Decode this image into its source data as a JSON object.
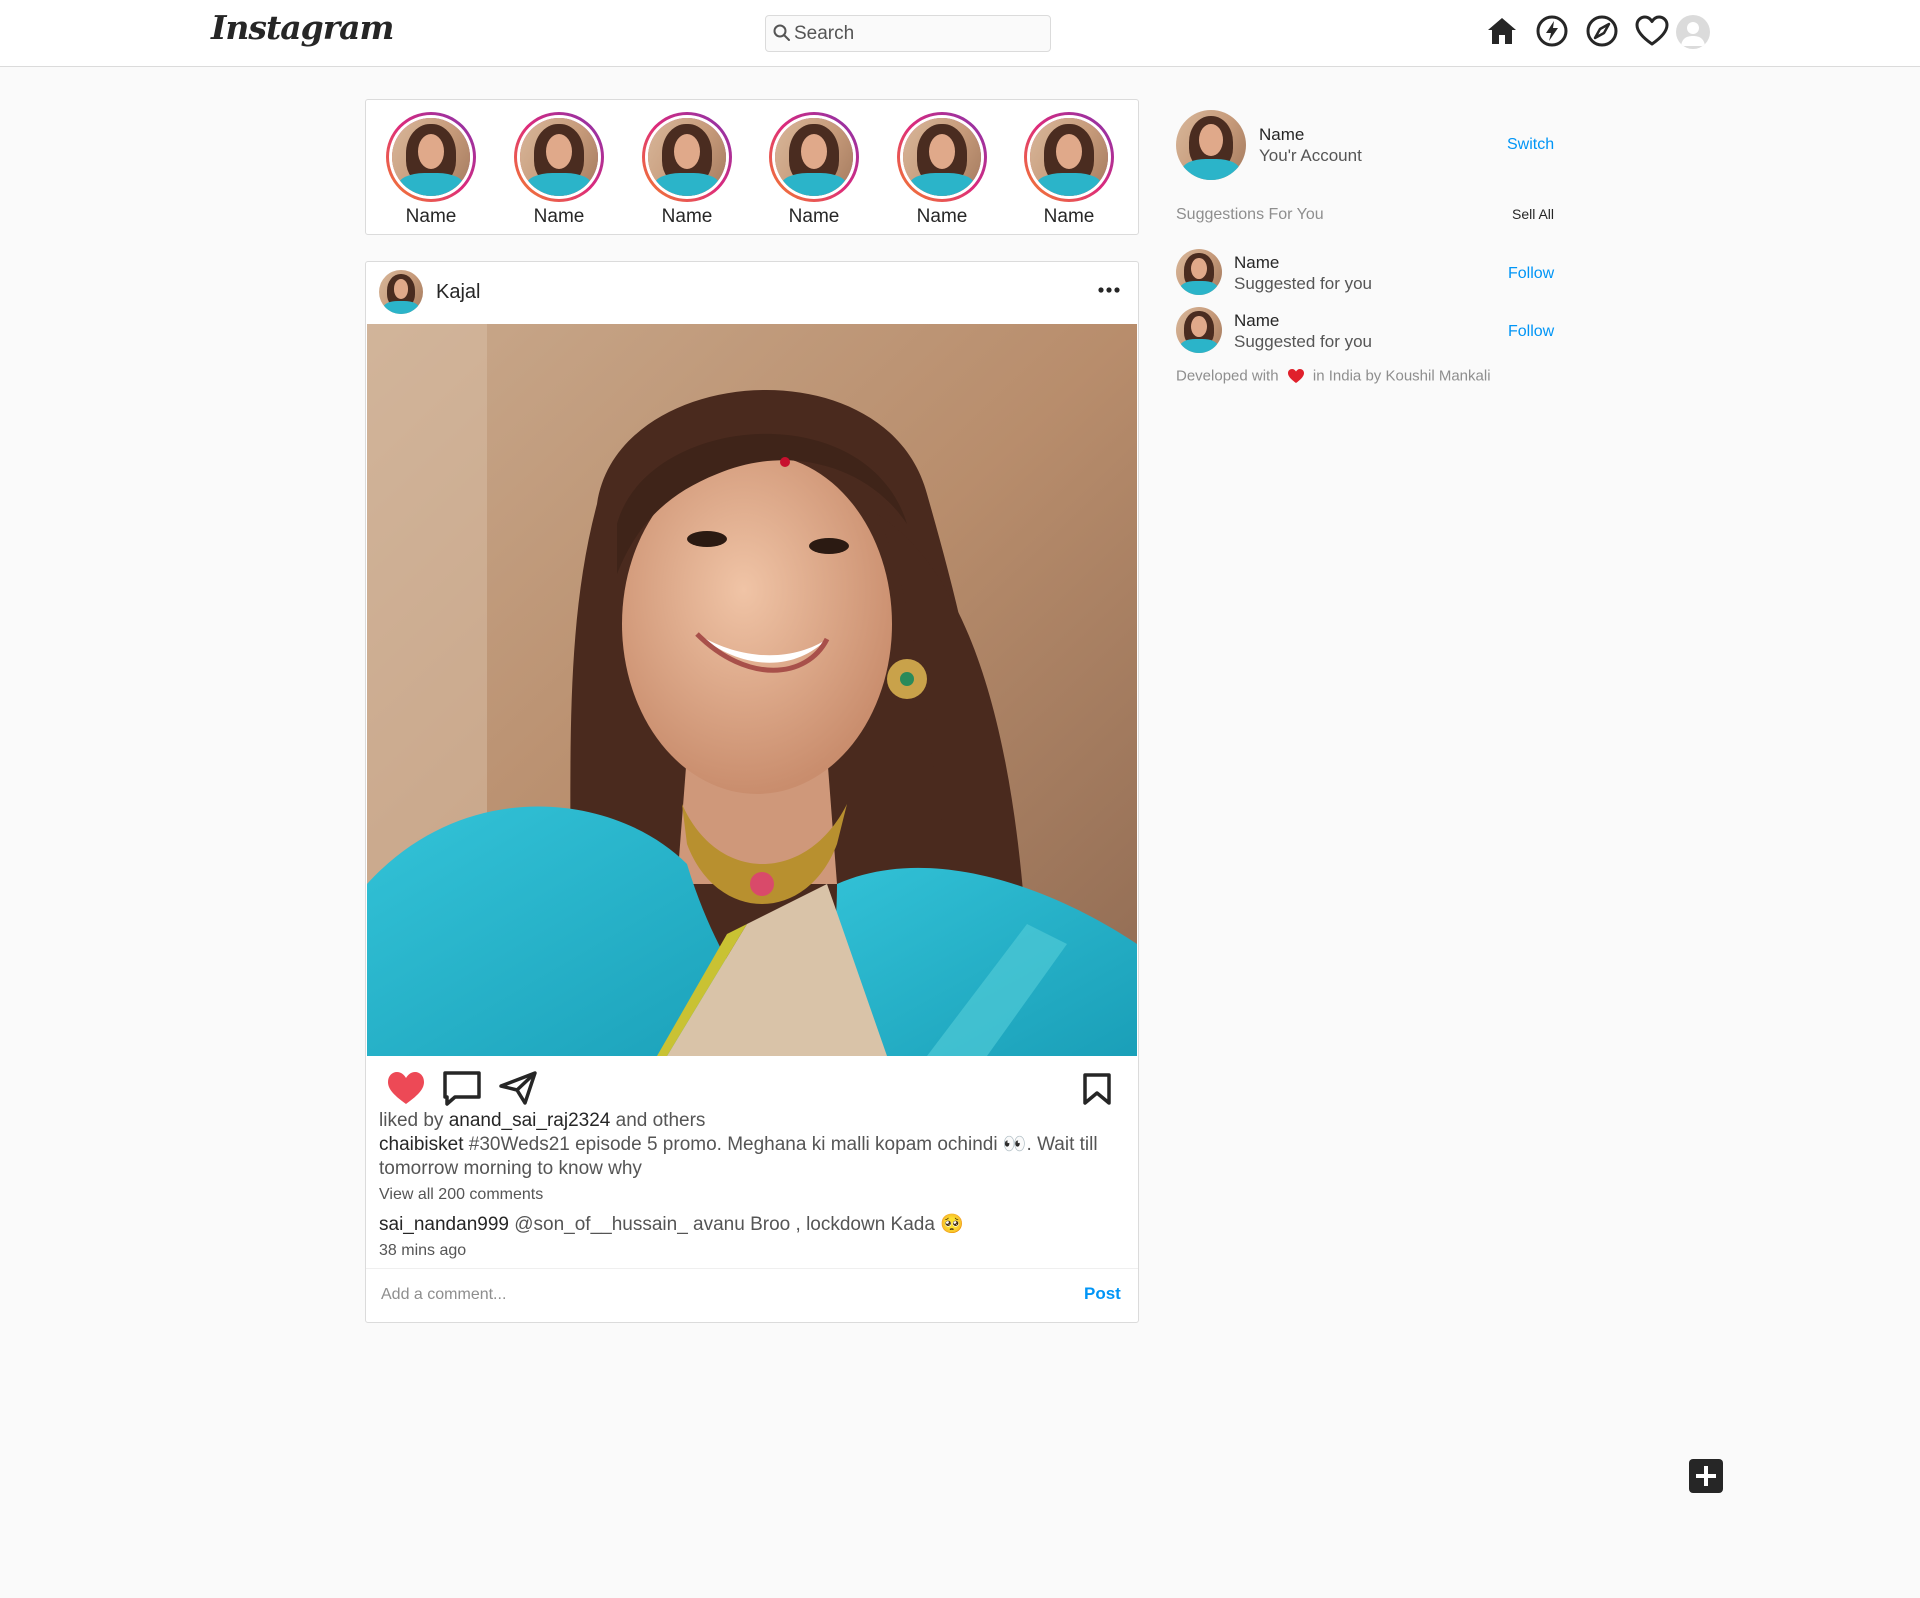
{
  "header": {
    "logo": "Instagram",
    "search_placeholder": "Search",
    "nav_icons": [
      "home-icon",
      "lightning-icon",
      "compass-icon",
      "heart-icon",
      "profile-avatar"
    ]
  },
  "stories": [
    {
      "name": "Name"
    },
    {
      "name": "Name"
    },
    {
      "name": "Name"
    },
    {
      "name": "Name"
    },
    {
      "name": "Name"
    },
    {
      "name": "Name"
    }
  ],
  "post": {
    "username": "Kajal",
    "liked_prefix": "liked by",
    "liked_user": "anand_sai_raj2324",
    "liked_suffix": "and others",
    "caption_user": "chaibisket",
    "caption_text": "#30Weds21 episode 5 promo. Meghana ki malli kopam ochindi 👀. Wait till tomorrow morning to know why",
    "view_comments": "View all 200 comments",
    "comment_user": "sai_nandan999",
    "comment_text": "@son_of__hussain_ avanu Broo , lockdown Kada 🥺",
    "time": "38 mins ago",
    "comment_placeholder": "Add a comment...",
    "post_button": "Post"
  },
  "sidebar": {
    "name": "Name",
    "sub": "You'r Account",
    "switch": "Switch",
    "suggestions_title": "Suggestions For You",
    "see_all": "Sell All",
    "suggestions": [
      {
        "name": "Name",
        "sub": "Suggested for you",
        "action": "Follow"
      },
      {
        "name": "Name",
        "sub": "Suggested for you",
        "action": "Follow"
      }
    ],
    "credit_prefix": "Developed with",
    "credit_middle": "in India by",
    "credit_author": "Koushil Mankali"
  },
  "colors": {
    "accent": "#0095f6",
    "like": "#ed4956",
    "border": "#dbdbdb"
  }
}
